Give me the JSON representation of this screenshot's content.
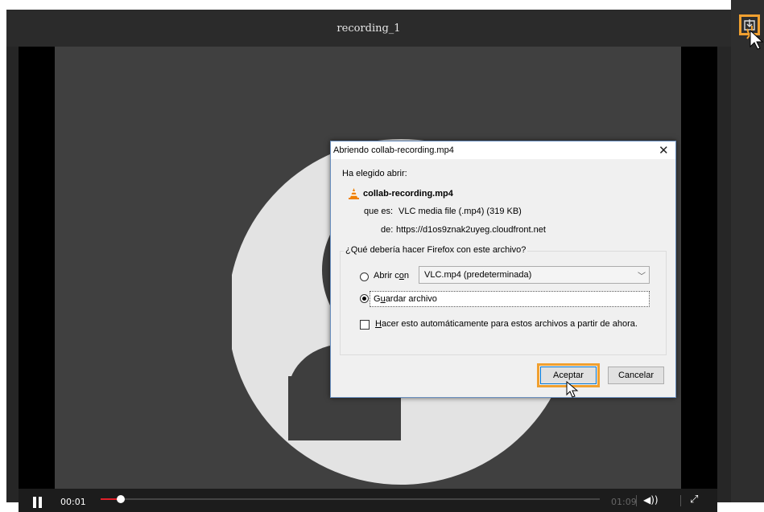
{
  "player": {
    "title": "recording_1",
    "current_time": "00:01",
    "duration": "01:09",
    "progress_fraction": 0.04
  },
  "side_panel": {
    "download_icon": "download-icon"
  },
  "dialog": {
    "title": "Abriendo collab-recording.mp4",
    "chosen_label": "Ha elegido abrir:",
    "file_name": "collab-recording.mp4",
    "type_label": "que es:",
    "type_value": "VLC media file (.mp4) (319 KB)",
    "from_label": "de:",
    "from_value": "https://d1os9znak2uyeg.cloudfront.net",
    "question": "¿Qué debería hacer Firefox con este archivo?",
    "open_with_label_a": "Abrir c",
    "open_with_label_key": "o",
    "open_with_label_b": "n",
    "open_with_value": "VLC.mp4 (predeterminada)",
    "save_label_a": "G",
    "save_label_key": "u",
    "save_label_b": "ardar archivo",
    "auto_label_key": "H",
    "auto_label_rest": "acer esto automáticamente para estos archivos a partir de ahora.",
    "accept_label": "Aceptar",
    "cancel_label": "Cancelar",
    "selected_option": "save",
    "auto_checked": false
  },
  "colors": {
    "highlight": "#f0a030",
    "progress": "#e0202a",
    "dialog_border": "#6a8fbf"
  }
}
